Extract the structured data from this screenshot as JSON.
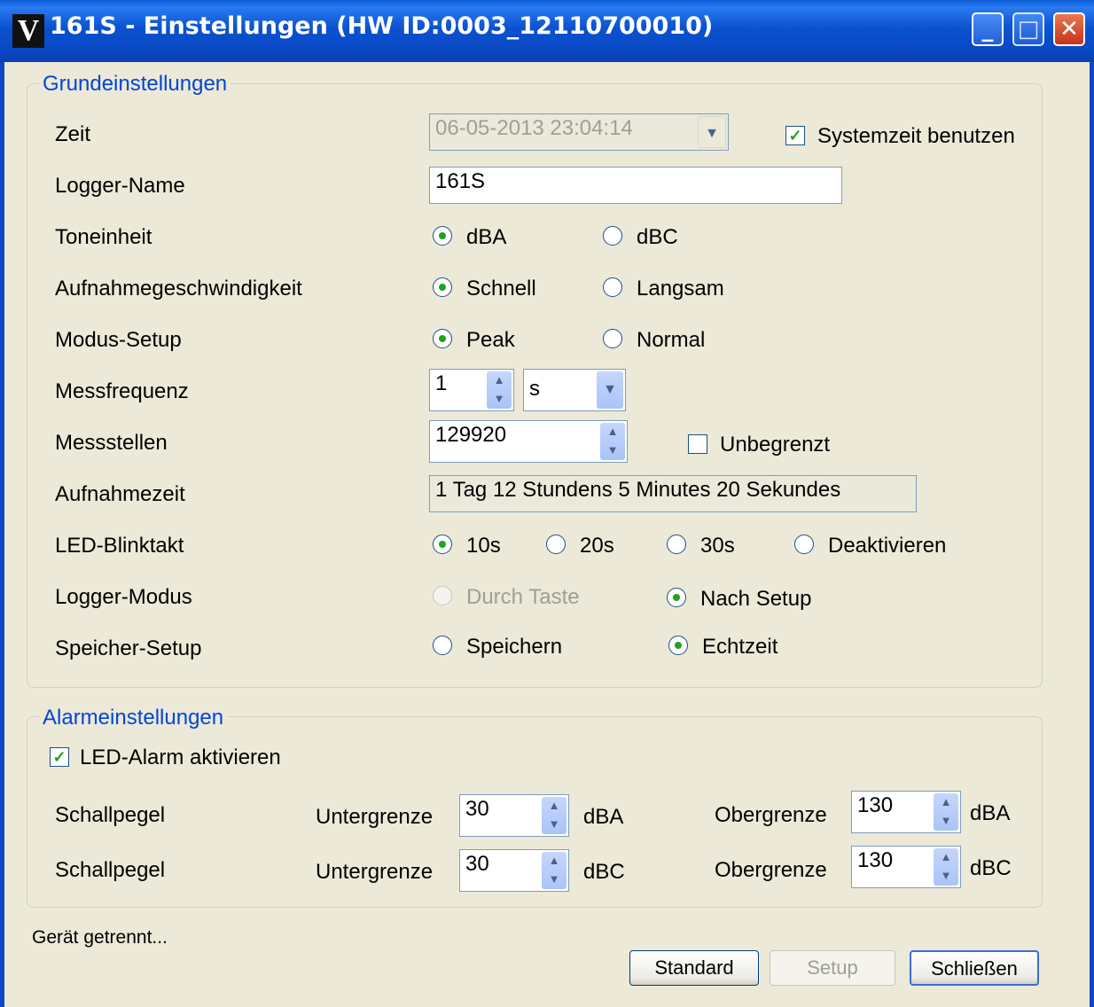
{
  "window": {
    "app_icon": "V",
    "title": "161S - Einstellungen (HW ID:0003_12110700010)",
    "minimize_icon": "minimize-icon",
    "maximize_icon": "maximize-icon",
    "close_icon": "close-icon"
  },
  "basic": {
    "legend": "Grundeinstellungen",
    "time": {
      "label": "Zeit",
      "value": "06-05-2013 23:04:14",
      "use_system_time": "Systemzeit benutzen",
      "use_system_checked": true
    },
    "logger_name": {
      "label": "Logger-Name",
      "value": "161S"
    },
    "tone_unit": {
      "label": "Toneinheit",
      "options": [
        "dBA",
        "dBC"
      ],
      "selected": "dBA"
    },
    "recording_speed": {
      "label": "Aufnahmegeschwindigkeit",
      "options": [
        "Schnell",
        "Langsam"
      ],
      "selected": "Schnell"
    },
    "mode_setup": {
      "label": "Modus-Setup",
      "options": [
        "Peak",
        "Normal"
      ],
      "selected": "Peak"
    },
    "sample_rate": {
      "label": "Messfrequenz",
      "value": "1",
      "unit": "s"
    },
    "sample_points": {
      "label": "Messstellen",
      "value": "129920",
      "unlimited_label": "Unbegrenzt",
      "unlimited_checked": false
    },
    "recording_time": {
      "label": "Aufnahmezeit",
      "value": "1 Tag 12 Stundens 5 Minutes 20 Sekundes"
    },
    "led_blink": {
      "label": "LED-Blinktakt",
      "options": [
        "10s",
        "20s",
        "30s",
        "Deaktivieren"
      ],
      "selected": "10s"
    },
    "logger_mode": {
      "label": "Logger-Modus",
      "options": [
        "Durch Taste",
        "Nach Setup"
      ],
      "selected": "Nach Setup"
    },
    "memory_setup": {
      "label": "Speicher-Setup",
      "options": [
        "Speichern",
        "Echtzeit"
      ],
      "selected": "Echtzeit"
    }
  },
  "alarm": {
    "legend": "Alarmeinstellungen",
    "led_alarm_label": "LED-Alarm aktivieren",
    "led_alarm_checked": true,
    "rows": [
      {
        "label": "Schallpegel",
        "lower_label": "Untergrenze",
        "lower_value": "30",
        "lower_unit": "dBA",
        "upper_label": "Obergrenze",
        "upper_value": "130",
        "upper_unit": "dBA"
      },
      {
        "label": "Schallpegel",
        "lower_label": "Untergrenze",
        "lower_value": "30",
        "lower_unit": "dBC",
        "upper_label": "Obergrenze",
        "upper_value": "130",
        "upper_unit": "dBC"
      }
    ]
  },
  "status": "Gerät getrennt...",
  "buttons": {
    "standard": "Standard",
    "setup": "Setup",
    "close": "Schließen"
  }
}
